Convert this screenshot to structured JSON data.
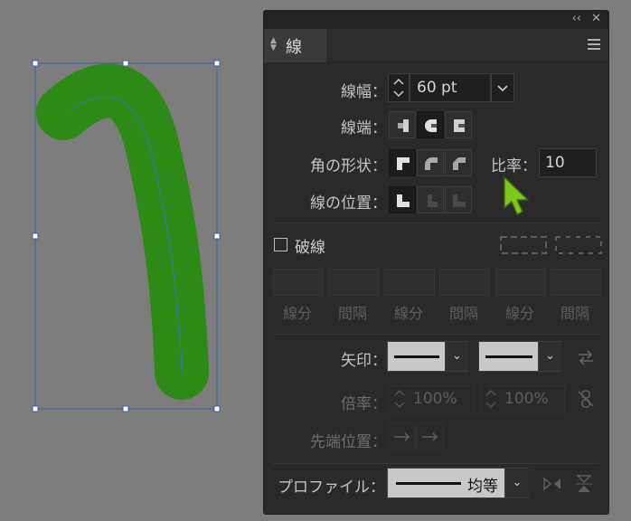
{
  "panel": {
    "title": "線",
    "stroke_weight": {
      "label": "線幅：",
      "value": "60 pt"
    },
    "cap": {
      "label": "線端："
    },
    "corner": {
      "label": "角の形状：",
      "limit_label": "比率：",
      "limit_value": "10"
    },
    "align": {
      "label": "線の位置："
    },
    "dashed": {
      "label": "破線",
      "checked": false,
      "cells": [
        "線分",
        "間隔",
        "線分",
        "間隔",
        "線分",
        "間隔"
      ]
    },
    "arrowheads": {
      "label": "矢印："
    },
    "scale": {
      "label": "倍率：",
      "start": "100%",
      "end": "100%"
    },
    "align_arrow": {
      "label": "先端位置："
    },
    "profile": {
      "label": "プロファイル：",
      "value": "均等"
    }
  },
  "colors": {
    "stroke": "#2e8a17",
    "path": "#3b6ec0",
    "panel_bg": "#2a2a2a",
    "canvas_bg": "#7d7d7d",
    "cursor": "#7dc91b"
  }
}
